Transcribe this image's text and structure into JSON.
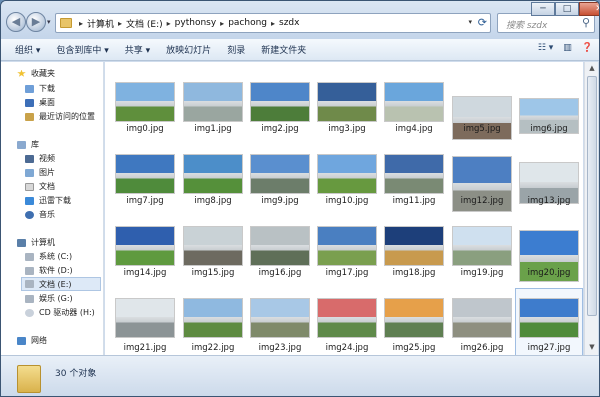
{
  "address": {
    "crumbs": [
      "计算机",
      "文档 (E:)",
      "pythonsy",
      "pachong",
      "szdx"
    ]
  },
  "search": {
    "placeholder": "搜索 szdx"
  },
  "window_controls": {
    "minimize": "─",
    "maximize": "□",
    "close": "✕"
  },
  "toolbar": {
    "organize": "组织 ▾",
    "include": "包含到库中 ▾",
    "share": "共享 ▾",
    "slideshow": "放映幻灯片",
    "burn": "刻录",
    "new_folder": "新建文件夹"
  },
  "nav": {
    "favorites": "收藏夹",
    "downloads": "下载",
    "desktop": "桌面",
    "recent": "最近访问的位置",
    "libraries": "库",
    "videos": "视频",
    "pictures": "图片",
    "documents": "文档",
    "thunder": "迅雷下载",
    "music": "音乐",
    "computer": "计算机",
    "drive_c": "系统 (C:)",
    "drive_d": "软件 (D:)",
    "drive_e": "文档 (E:)",
    "drive_g": "娱乐 (G:)",
    "drive_h": "CD 驱动器 (H:)",
    "network": "网络"
  },
  "files": [
    "img0.jpg",
    "img1.jpg",
    "img2.jpg",
    "img3.jpg",
    "img4.jpg",
    "img5.jpg",
    "img6.jpg",
    "img7.jpg",
    "img8.jpg",
    "img9.jpg",
    "img10.jpg",
    "img11.jpg",
    "img12.jpg",
    "img13.jpg",
    "img14.jpg",
    "img15.jpg",
    "img16.jpg",
    "img17.jpg",
    "img18.jpg",
    "img19.jpg",
    "img20.jpg",
    "img21.jpg",
    "img22.jpg",
    "img23.jpg",
    "img24.jpg",
    "img25.jpg",
    "img26.jpg",
    "img27.jpg"
  ],
  "status": {
    "count": "30 个对象"
  },
  "colors": {
    "accent": "#2b5b93",
    "selection": "#dde9f7"
  }
}
